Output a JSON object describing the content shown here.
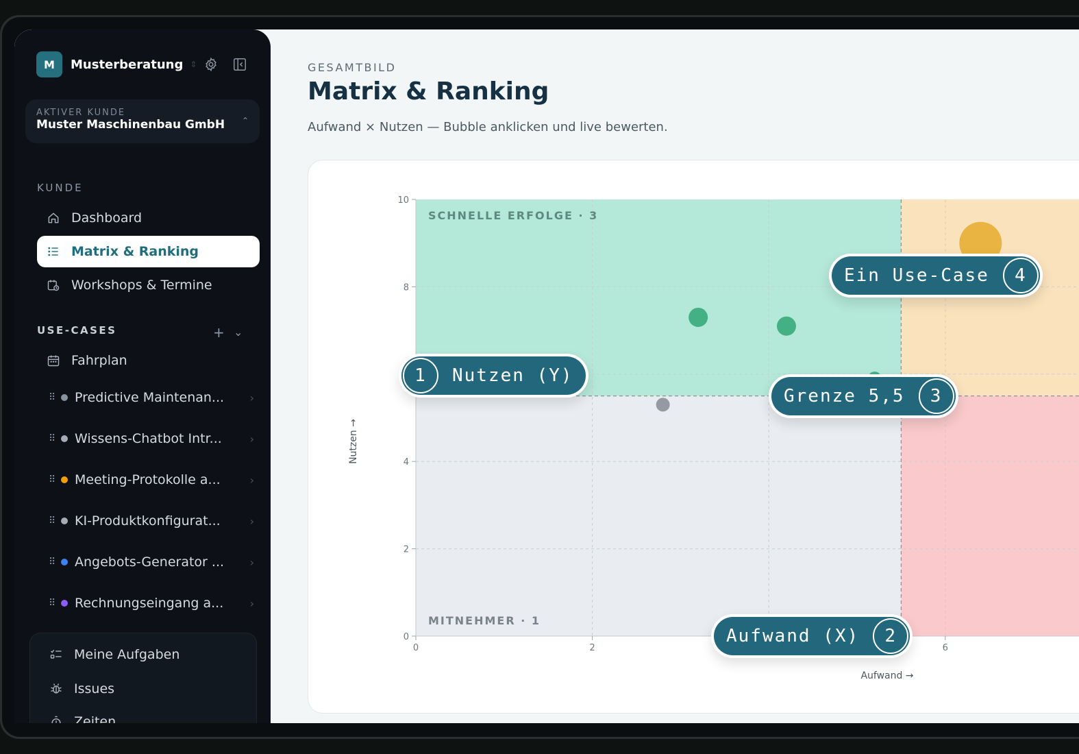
{
  "brand": {
    "initial": "M",
    "name": "Musterberatung"
  },
  "active_customer": {
    "label": "AKTIVER KUNDE",
    "name": "Muster Maschinenbau GmbH"
  },
  "sections": {
    "kunde": "KUNDE",
    "use_cases": "USE-CASES"
  },
  "nav": {
    "dashboard": "Dashboard",
    "matrix": "Matrix & Ranking",
    "workshops": "Workshops & Termine",
    "fahrplan": "Fahrplan"
  },
  "use_cases": [
    {
      "label": "Predictive Maintenan...",
      "color": "#8a92a0"
    },
    {
      "label": "Wissens-Chatbot Intr...",
      "color": "#a4acb8"
    },
    {
      "label": "Meeting-Protokolle a...",
      "color": "#f59e0b"
    },
    {
      "label": "KI-Produktkonfigurat...",
      "color": "#a4acb8"
    },
    {
      "label": "Angebots-Generator ...",
      "color": "#3b82f6"
    },
    {
      "label": "Rechnungseingang a...",
      "color": "#8b5cf6"
    }
  ],
  "bottom_nav": {
    "tasks": "Meine Aufgaben",
    "issues": "Issues",
    "times": "Zeiten"
  },
  "page": {
    "eyebrow": "GESAMTBILD",
    "title": "Matrix & Ranking",
    "subtitle": "Aufwand × Nutzen — Bubble anklicken und live bewerten."
  },
  "chart_data": {
    "type": "scatter",
    "xlabel": "Aufwand →",
    "ylabel": "Nutzen →",
    "xlim": [
      0,
      10
    ],
    "ylim": [
      0,
      10
    ],
    "xticks": [
      0,
      2,
      6
    ],
    "yticks": [
      0,
      2,
      4,
      8,
      10
    ],
    "threshold": 5.5,
    "quadrants": [
      {
        "label": "SCHNELLE ERFOLGE · 3",
        "color": "#b4e8d8"
      },
      {
        "label": "",
        "color": "#f9e2bc"
      },
      {
        "label": "MITNEHMER · 1",
        "color": "#e9ecf0"
      },
      {
        "label": "",
        "color": "#f9c9cb"
      }
    ],
    "points": [
      {
        "x": 3.2,
        "y": 7.3,
        "r": 14,
        "color": "#3dae80"
      },
      {
        "x": 4.2,
        "y": 7.1,
        "r": 14,
        "color": "#3dae80"
      },
      {
        "x": 2.8,
        "y": 5.3,
        "r": 10,
        "color": "#8f959e"
      },
      {
        "x": 5.2,
        "y": 5.9,
        "r": 10,
        "color": "#3dae80"
      },
      {
        "x": 6.4,
        "y": 9.0,
        "r": 31,
        "color": "#e8b13a"
      }
    ]
  },
  "callouts": [
    {
      "num": "1",
      "text": "Nutzen (Y)"
    },
    {
      "num": "2",
      "text": "Aufwand (X)"
    },
    {
      "num": "3",
      "text": "Grenze 5,5"
    },
    {
      "num": "4",
      "text": "Ein Use-Case"
    }
  ]
}
